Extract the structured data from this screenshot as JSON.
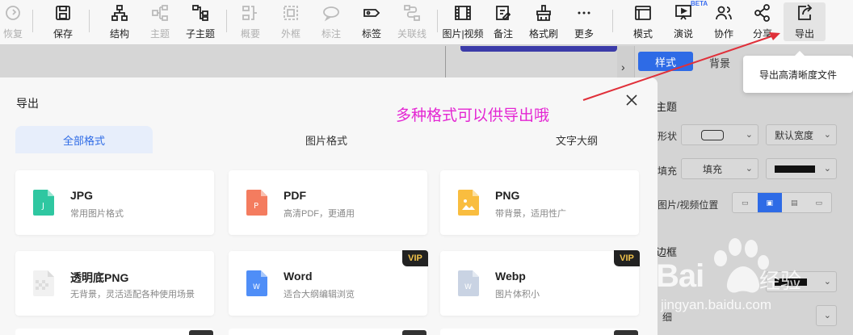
{
  "toolbar": {
    "items": [
      {
        "label": "恢复",
        "icon": "redo-icon",
        "disabled": true
      },
      {
        "label": "保存",
        "icon": "save-icon"
      },
      {
        "label": "结构",
        "icon": "structure-icon"
      },
      {
        "label": "主题",
        "icon": "topic-icon",
        "disabled": true
      },
      {
        "label": "子主题",
        "icon": "subtopic-icon"
      },
      {
        "label": "概要",
        "icon": "summary-icon",
        "disabled": true
      },
      {
        "label": "外框",
        "icon": "frame-icon",
        "disabled": true
      },
      {
        "label": "标注",
        "icon": "callout-icon",
        "disabled": true
      },
      {
        "label": "标签",
        "icon": "tag-icon"
      },
      {
        "label": "关联线",
        "icon": "relation-line-icon",
        "disabled": true
      },
      {
        "label": "图片|视频",
        "icon": "image-video-icon"
      },
      {
        "label": "备注",
        "icon": "note-icon"
      },
      {
        "label": "格式刷",
        "icon": "format-brush-icon"
      },
      {
        "label": "更多",
        "icon": "more-icon"
      },
      {
        "label": "模式",
        "icon": "mode-icon"
      },
      {
        "label": "演说",
        "icon": "present-icon"
      },
      {
        "label": "协作",
        "icon": "collaborate-icon"
      },
      {
        "label": "分享",
        "icon": "share-icon"
      },
      {
        "label": "导出",
        "icon": "export-icon",
        "active": true
      }
    ],
    "beta": "BETA"
  },
  "tooltip": "导出高清晰度文件",
  "annotation": "多种格式可以供导出哦",
  "modal": {
    "title": "导出",
    "tabs": [
      {
        "label": "全部格式",
        "active": true
      },
      {
        "label": "图片格式"
      },
      {
        "label": "文字大纲"
      }
    ],
    "cards": [
      {
        "name": "JPG",
        "desc": "常用图片格式",
        "icon": "jpg-file-icon",
        "glyph": "J",
        "color": "#2fc7a1"
      },
      {
        "name": "PDF",
        "desc": "高清PDF，更通用",
        "icon": "pdf-file-icon",
        "glyph": "P",
        "color": "#f47c5f"
      },
      {
        "name": "PNG",
        "desc": "带背景，适用性广",
        "icon": "png-file-icon",
        "glyph": "",
        "color": "#f9bd3f"
      },
      {
        "name": "透明底PNG",
        "desc": "无背景，灵活适配各种使用场景",
        "icon": "transparent-png-file-icon",
        "glyph": "",
        "color": "#e8e8e8"
      },
      {
        "name": "Word",
        "desc": "适合大纲编辑浏览",
        "icon": "word-file-icon",
        "glyph": "W",
        "color": "#4f8ef7",
        "vip": "VIP"
      },
      {
        "name": "Webp",
        "desc": "图片体积小",
        "icon": "webp-file-icon",
        "glyph": "W",
        "color": "#c9d3e3",
        "vip": "VIP"
      }
    ]
  },
  "panel": {
    "tab_style": "样式",
    "tab_background": "背景",
    "section_topic": "主题",
    "shape_label": "形状",
    "width_value": "默认宽度",
    "fill_label": "填充",
    "fill_value": "填充",
    "image_pos_label": "图片/视频位置",
    "section_border": "边框",
    "border_width": "细"
  },
  "watermark": {
    "brand": "Bai",
    "cn": "经验",
    "url": "jingyan.baidu.com"
  },
  "colors": {
    "accent": "#2e6be6",
    "annotation": "#e426d3",
    "arrow": "#e0303a",
    "vip_bg": "#222222",
    "vip_text": "#f0c24a"
  }
}
